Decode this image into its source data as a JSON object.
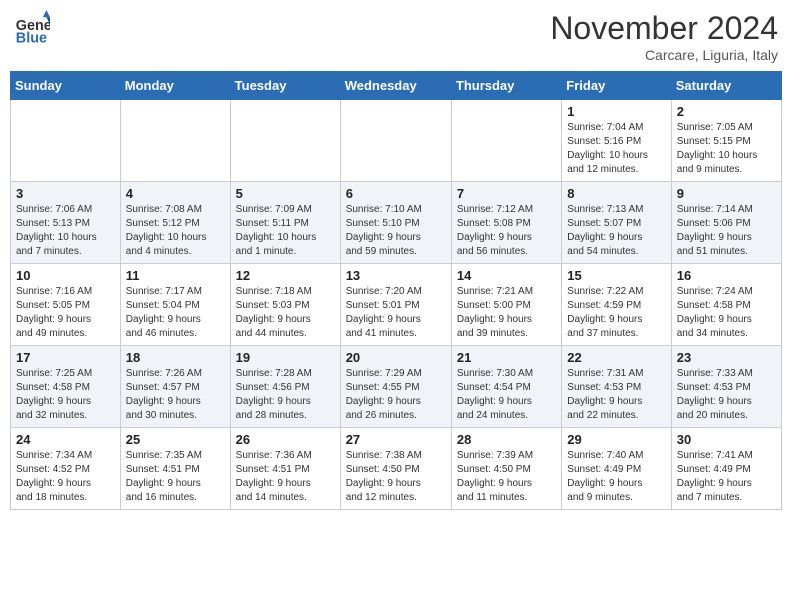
{
  "header": {
    "logo_general": "General",
    "logo_blue": "Blue",
    "month": "November 2024",
    "location": "Carcare, Liguria, Italy"
  },
  "weekdays": [
    "Sunday",
    "Monday",
    "Tuesday",
    "Wednesday",
    "Thursday",
    "Friday",
    "Saturday"
  ],
  "weeks": [
    [
      {
        "day": "",
        "info": ""
      },
      {
        "day": "",
        "info": ""
      },
      {
        "day": "",
        "info": ""
      },
      {
        "day": "",
        "info": ""
      },
      {
        "day": "",
        "info": ""
      },
      {
        "day": "1",
        "info": "Sunrise: 7:04 AM\nSunset: 5:16 PM\nDaylight: 10 hours\nand 12 minutes."
      },
      {
        "day": "2",
        "info": "Sunrise: 7:05 AM\nSunset: 5:15 PM\nDaylight: 10 hours\nand 9 minutes."
      }
    ],
    [
      {
        "day": "3",
        "info": "Sunrise: 7:06 AM\nSunset: 5:13 PM\nDaylight: 10 hours\nand 7 minutes."
      },
      {
        "day": "4",
        "info": "Sunrise: 7:08 AM\nSunset: 5:12 PM\nDaylight: 10 hours\nand 4 minutes."
      },
      {
        "day": "5",
        "info": "Sunrise: 7:09 AM\nSunset: 5:11 PM\nDaylight: 10 hours\nand 1 minute."
      },
      {
        "day": "6",
        "info": "Sunrise: 7:10 AM\nSunset: 5:10 PM\nDaylight: 9 hours\nand 59 minutes."
      },
      {
        "day": "7",
        "info": "Sunrise: 7:12 AM\nSunset: 5:08 PM\nDaylight: 9 hours\nand 56 minutes."
      },
      {
        "day": "8",
        "info": "Sunrise: 7:13 AM\nSunset: 5:07 PM\nDaylight: 9 hours\nand 54 minutes."
      },
      {
        "day": "9",
        "info": "Sunrise: 7:14 AM\nSunset: 5:06 PM\nDaylight: 9 hours\nand 51 minutes."
      }
    ],
    [
      {
        "day": "10",
        "info": "Sunrise: 7:16 AM\nSunset: 5:05 PM\nDaylight: 9 hours\nand 49 minutes."
      },
      {
        "day": "11",
        "info": "Sunrise: 7:17 AM\nSunset: 5:04 PM\nDaylight: 9 hours\nand 46 minutes."
      },
      {
        "day": "12",
        "info": "Sunrise: 7:18 AM\nSunset: 5:03 PM\nDaylight: 9 hours\nand 44 minutes."
      },
      {
        "day": "13",
        "info": "Sunrise: 7:20 AM\nSunset: 5:01 PM\nDaylight: 9 hours\nand 41 minutes."
      },
      {
        "day": "14",
        "info": "Sunrise: 7:21 AM\nSunset: 5:00 PM\nDaylight: 9 hours\nand 39 minutes."
      },
      {
        "day": "15",
        "info": "Sunrise: 7:22 AM\nSunset: 4:59 PM\nDaylight: 9 hours\nand 37 minutes."
      },
      {
        "day": "16",
        "info": "Sunrise: 7:24 AM\nSunset: 4:58 PM\nDaylight: 9 hours\nand 34 minutes."
      }
    ],
    [
      {
        "day": "17",
        "info": "Sunrise: 7:25 AM\nSunset: 4:58 PM\nDaylight: 9 hours\nand 32 minutes."
      },
      {
        "day": "18",
        "info": "Sunrise: 7:26 AM\nSunset: 4:57 PM\nDaylight: 9 hours\nand 30 minutes."
      },
      {
        "day": "19",
        "info": "Sunrise: 7:28 AM\nSunset: 4:56 PM\nDaylight: 9 hours\nand 28 minutes."
      },
      {
        "day": "20",
        "info": "Sunrise: 7:29 AM\nSunset: 4:55 PM\nDaylight: 9 hours\nand 26 minutes."
      },
      {
        "day": "21",
        "info": "Sunrise: 7:30 AM\nSunset: 4:54 PM\nDaylight: 9 hours\nand 24 minutes."
      },
      {
        "day": "22",
        "info": "Sunrise: 7:31 AM\nSunset: 4:53 PM\nDaylight: 9 hours\nand 22 minutes."
      },
      {
        "day": "23",
        "info": "Sunrise: 7:33 AM\nSunset: 4:53 PM\nDaylight: 9 hours\nand 20 minutes."
      }
    ],
    [
      {
        "day": "24",
        "info": "Sunrise: 7:34 AM\nSunset: 4:52 PM\nDaylight: 9 hours\nand 18 minutes."
      },
      {
        "day": "25",
        "info": "Sunrise: 7:35 AM\nSunset: 4:51 PM\nDaylight: 9 hours\nand 16 minutes."
      },
      {
        "day": "26",
        "info": "Sunrise: 7:36 AM\nSunset: 4:51 PM\nDaylight: 9 hours\nand 14 minutes."
      },
      {
        "day": "27",
        "info": "Sunrise: 7:38 AM\nSunset: 4:50 PM\nDaylight: 9 hours\nand 12 minutes."
      },
      {
        "day": "28",
        "info": "Sunrise: 7:39 AM\nSunset: 4:50 PM\nDaylight: 9 hours\nand 11 minutes."
      },
      {
        "day": "29",
        "info": "Sunrise: 7:40 AM\nSunset: 4:49 PM\nDaylight: 9 hours\nand 9 minutes."
      },
      {
        "day": "30",
        "info": "Sunrise: 7:41 AM\nSunset: 4:49 PM\nDaylight: 9 hours\nand 7 minutes."
      }
    ]
  ]
}
